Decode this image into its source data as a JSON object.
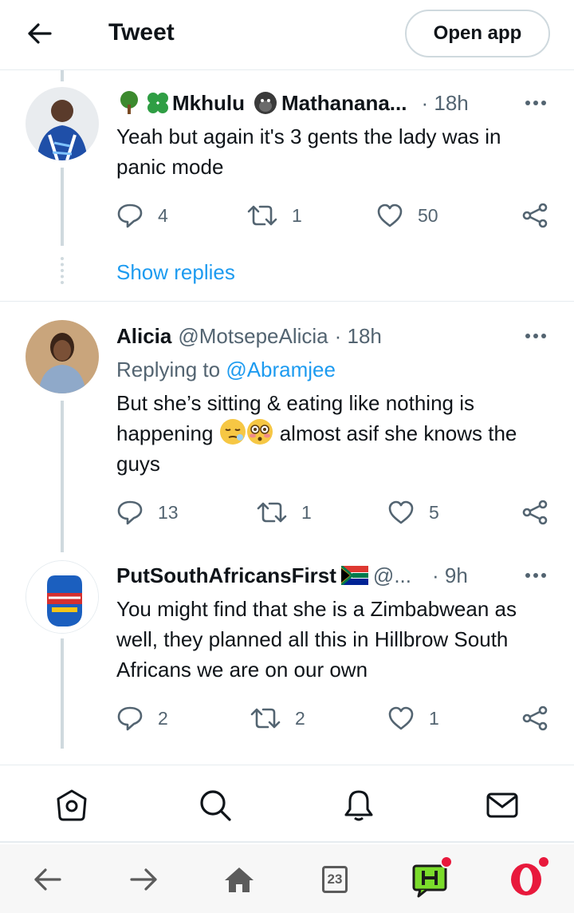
{
  "header": {
    "title": "Tweet",
    "open_app_label": "Open app"
  },
  "tweets": [
    {
      "name_part1": "Mkhulu",
      "name_part2": "Mathanana...",
      "time": "· 18h",
      "text": "Yeah but again it's 3 gents the lady was in panic mode",
      "replies": "4",
      "retweets": "1",
      "likes": "50"
    },
    {
      "name": "Alicia",
      "handle": "@MotsepeAlicia",
      "time": "· 18h",
      "replying_prefix": "Replying to ",
      "replying_to": "@Abramjee",
      "text_before_emoji": "But she’s sitting & eating like nothing is happening",
      "text_after_emoji": "almost asif she knows the guys",
      "replies": "13",
      "retweets": "1",
      "likes": "5"
    },
    {
      "name": "PutSouthAfricansFirst",
      "handle": "@...",
      "time": "· 9h",
      "text": "You might find that she is a Zimbabwean as well, they planned all this in Hillbrow South Africans we are on our own",
      "replies": "2",
      "retweets": "2",
      "likes": "1"
    }
  ],
  "show_replies_label": "Show replies",
  "browser": {
    "tab_count": "23"
  },
  "colors": {
    "link": "#1d9bf0",
    "secondary_text": "#536471",
    "primary_text": "#0f1419",
    "thread_line": "#cfd9de",
    "opera_red": "#e8193c"
  },
  "icons": {
    "tw_nav": [
      "home-icon",
      "search-icon",
      "notifications-bell-icon",
      "messages-mail-icon"
    ],
    "browser_bar": [
      "back-arrow-icon",
      "forward-arrow-icon",
      "home-icon",
      "tabs-icon",
      "news-app-icon",
      "opera-icon"
    ]
  }
}
